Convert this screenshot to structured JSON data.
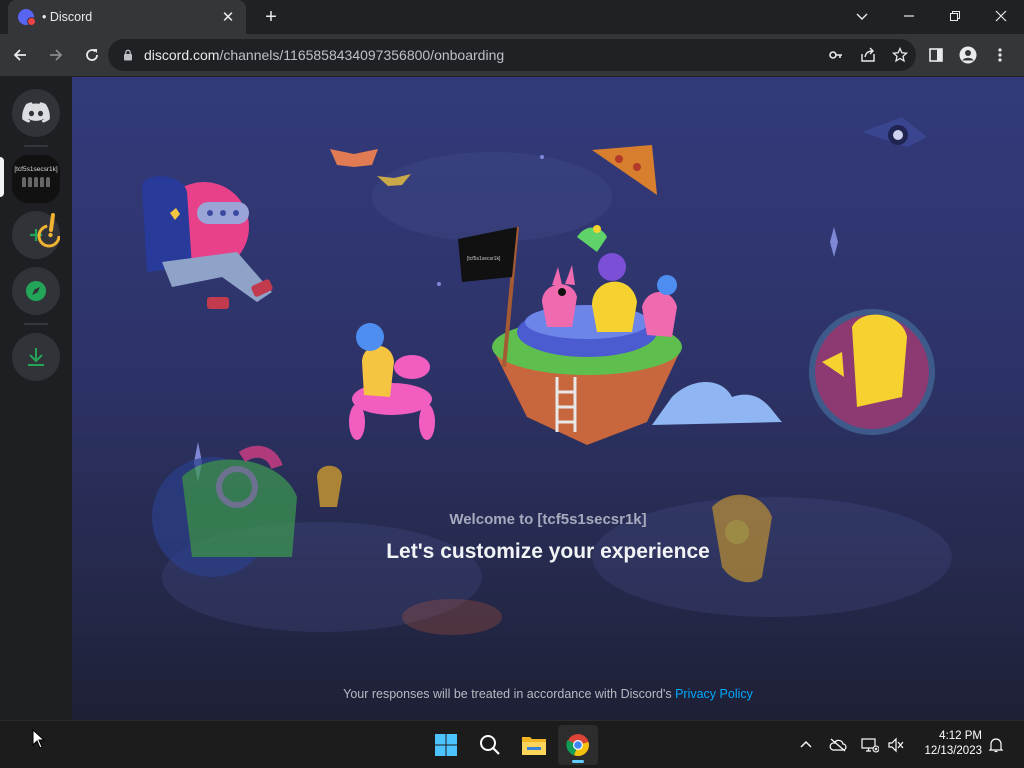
{
  "browser": {
    "tab_title": "• Discord",
    "url_host": "discord.com",
    "url_path": "/channels/1165858434097356800/onboarding"
  },
  "rail": {
    "server_name": "[tcf5s1secsr1k]",
    "accent": "#23a559"
  },
  "onboarding": {
    "welcome": "Welcome to [tcf5s1secsr1k]",
    "headline": "Let's customize your experience",
    "footer_text": "Your responses will be treated in accordance with Discord's ",
    "privacy_link": "Privacy Policy",
    "flag_text": "[tcf5s1secsr1k]"
  },
  "taskbar": {
    "time": "4:12 PM",
    "date": "12/13/2023"
  }
}
